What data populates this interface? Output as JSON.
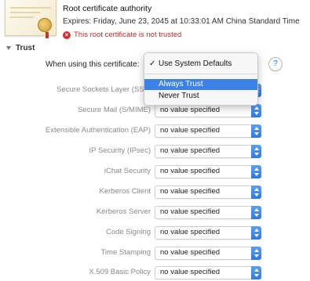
{
  "certificate": {
    "name": "Root certificate authority",
    "expires": "Expires: Friday, June 23, 2045 at 10:33:01 AM China Standard Time",
    "warning": "This root certificate is not trusted"
  },
  "trust": {
    "header": "Trust",
    "when_using_label": "When using this certificate:",
    "popup": {
      "checked_label": "Use System Defaults",
      "options": [
        "Always Trust",
        "Never Trust"
      ],
      "highlighted": "Always Trust"
    },
    "help_label": "?",
    "policies": [
      {
        "label": "Secure Sockets Layer (SSL)",
        "value": ""
      },
      {
        "label": "Secure Mail (S/MIME)",
        "value": "no value specified"
      },
      {
        "label": "Extensible Authentication (EAP)",
        "value": "no value specified"
      },
      {
        "label": "IP Security (IPsec)",
        "value": "no value specified"
      },
      {
        "label": "iChat Security",
        "value": "no value specified"
      },
      {
        "label": "Kerberos Client",
        "value": "no value specified"
      },
      {
        "label": "Kerberos Server",
        "value": "no value specified"
      },
      {
        "label": "Code Signing",
        "value": "no value specified"
      },
      {
        "label": "Time Stamping",
        "value": "no value specified"
      },
      {
        "label": "X.509 Basic Policy",
        "value": "no value specified"
      }
    ]
  },
  "colors": {
    "accent": "#3b82e6",
    "warning": "#c62828"
  }
}
